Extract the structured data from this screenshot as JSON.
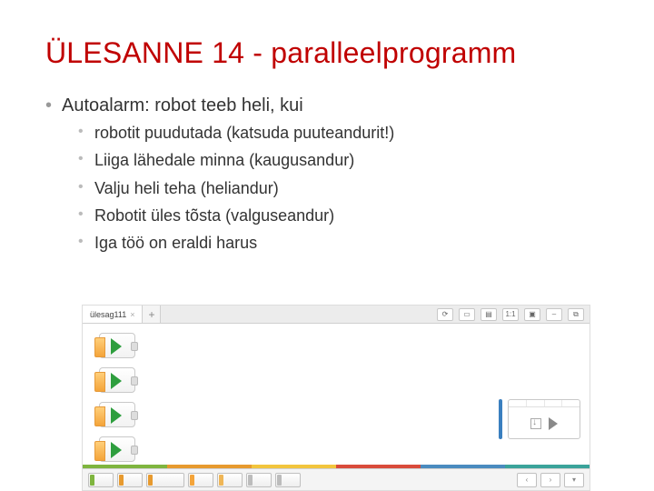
{
  "title": "ÜLESANNE 14 - paralleelprogramm",
  "main_bullet": "Autoalarm: robot teeb heli, kui",
  "sub_bullets": [
    "robotit puudutada (katsuda puuteandurit!)",
    "Liiga lähedale minna (kaugusandur)",
    "Valju heli teha (heliandur)",
    "Robotit üles tõsta (valguseandur)",
    "Iga töö on eraldi harus"
  ],
  "ide": {
    "tab_label": "ülesag111",
    "tab_close": "×",
    "add_tab": "+",
    "toolbar_icons": [
      "⟳",
      "▭",
      "▤",
      "1:1",
      "▣",
      "–",
      "⧉"
    ]
  }
}
